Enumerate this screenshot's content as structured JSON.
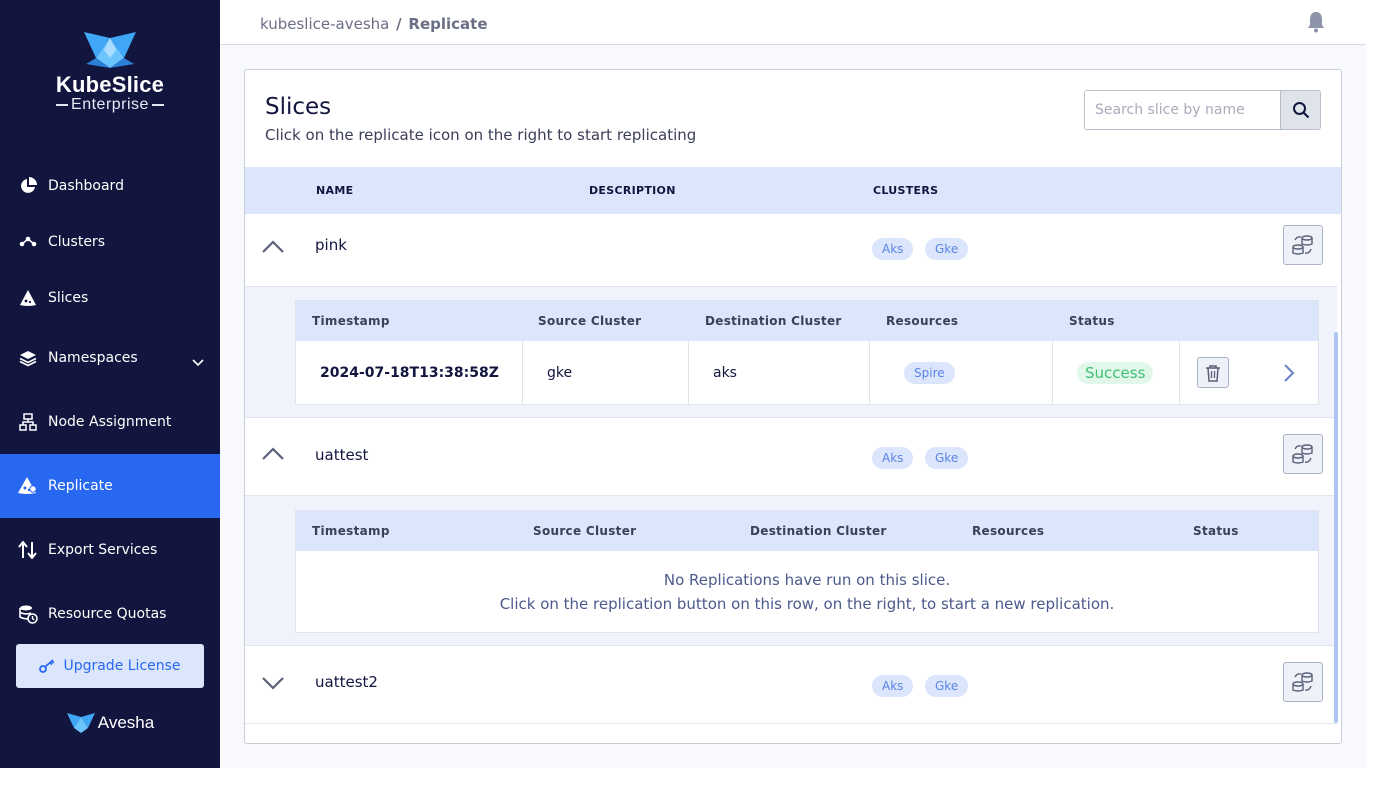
{
  "brand": {
    "title": "KubeSlice",
    "subtitle": "Enterprise",
    "footer_logo": "Avesha"
  },
  "sidebar": {
    "items": [
      {
        "label": "Dashboard",
        "icon": "pie-chart-icon"
      },
      {
        "label": "Clusters",
        "icon": "clusters-icon"
      },
      {
        "label": "Slices",
        "icon": "slices-icon"
      },
      {
        "label": "Namespaces",
        "icon": "layers-icon"
      },
      {
        "label": "Node Assignment",
        "icon": "node-tree-icon"
      },
      {
        "label": "Replicate",
        "icon": "replicate-icon"
      },
      {
        "label": "Export Services",
        "icon": "arrows-up-down-icon"
      },
      {
        "label": "Resource Quotas",
        "icon": "database-clock-icon"
      }
    ],
    "active": "Replicate",
    "upgrade_label": "Upgrade License"
  },
  "header": {
    "breadcrumb_root": "kubeslice-avesha",
    "breadcrumb_separator": "/",
    "breadcrumb_current": "Replicate"
  },
  "card": {
    "title": "Slices",
    "subtitle": "Click on the replicate icon on the right to start replicating",
    "search_placeholder": "Search slice by name",
    "columns": [
      "NAME",
      "DESCRIPTION",
      "CLUSTERS"
    ]
  },
  "slices": [
    {
      "name": "pink",
      "expanded": true,
      "clusters": [
        "Aks",
        "Gke"
      ],
      "replication_columns": [
        "Timestamp",
        "Source Cluster",
        "Destination Cluster",
        "Resources",
        "Status"
      ],
      "replications": [
        {
          "timestamp": "2024-07-18T13:38:58Z",
          "source": "gke",
          "destination": "aks",
          "resources": "Spire",
          "status": "Success"
        }
      ]
    },
    {
      "name": "uattest",
      "expanded": true,
      "clusters": [
        "Aks",
        "Gke"
      ],
      "replication_columns": [
        "Timestamp",
        "Source Cluster",
        "Destination Cluster",
        "Resources",
        "Status"
      ],
      "empty_line1": "No Replications have run on this slice.",
      "empty_line2": "Click on the replication button on this row, on the right, to start a new replication."
    },
    {
      "name": "uattest2",
      "expanded": false,
      "clusters": [
        "Aks",
        "Gke"
      ]
    }
  ],
  "colors": {
    "sidebar_bg": "#12153e",
    "accent": "#2868f0",
    "header_row_bg": "#dbe5fb",
    "success": "#3fbf73"
  }
}
